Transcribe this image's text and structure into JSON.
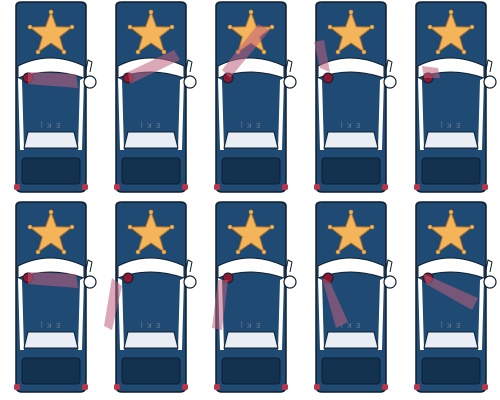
{
  "sprite_sheet": {
    "background": "#ffffff",
    "frames": [
      {
        "label": "ꟾ ꓘ ꓱ",
        "beam": "left"
      },
      {
        "label": "ꟾ ꓘ ꓱ",
        "beam": "up-right"
      },
      {
        "label": "ꟾ ꓘ ꓱ",
        "beam": "up-right-high"
      },
      {
        "label": "ꟾ ꓘ ꓱ",
        "beam": "up"
      },
      {
        "label": "ꟾ ꓘ ꓱ",
        "beam": "left-short"
      },
      {
        "label": "ꟾ ꓘ ꓱ",
        "beam": "left"
      },
      {
        "label": "ꟾ ꓘ ꓱ",
        "beam": "down-left"
      },
      {
        "label": "ꟾ ꓘ ꓱ",
        "beam": "down"
      },
      {
        "label": "ꟾ ꓘ ꓱ",
        "beam": "down-right"
      },
      {
        "label": "ꟾ ꓘ ꓱ",
        "beam": "right"
      }
    ],
    "colors": {
      "body": "#1f4a73",
      "body_dark": "#163a5c",
      "outline": "#0f1e2e",
      "star": "#f4b45a",
      "star_outline": "#b8782a",
      "roof_band": "#ffffff",
      "light": "#8a1830",
      "beam": "#c0607e",
      "bumper": "#12324f",
      "wheel": "#b8324a",
      "mirror": "#ffffff"
    }
  }
}
